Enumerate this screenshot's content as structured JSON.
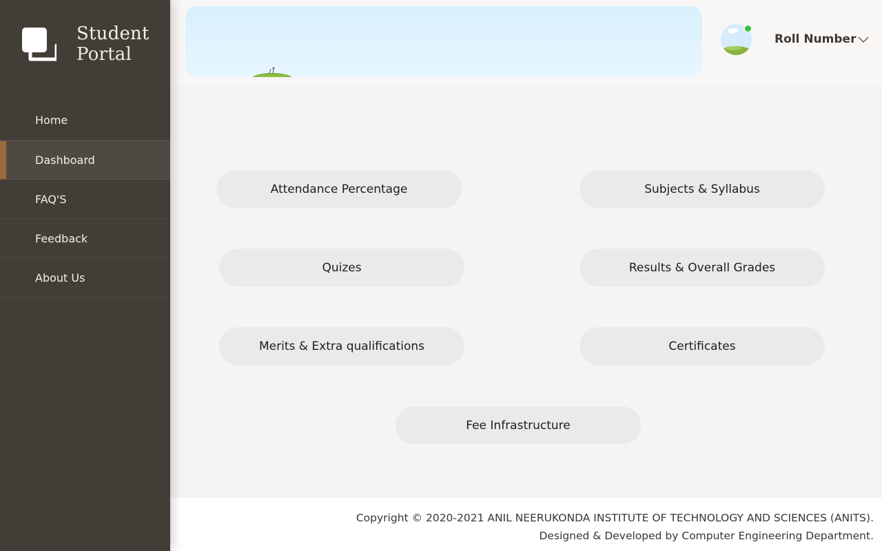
{
  "brand": {
    "title_line1": "Student",
    "title_line2": "Portal"
  },
  "sidebar": {
    "items": [
      {
        "label": "Home",
        "active": false
      },
      {
        "label": "Dashboard",
        "active": true
      },
      {
        "label": "FAQ'S",
        "active": false
      },
      {
        "label": "Feedback",
        "active": false
      },
      {
        "label": "About Us",
        "active": false
      }
    ]
  },
  "header": {
    "user_menu_label": "Roll Number",
    "avatar_status": "online"
  },
  "dashboard": {
    "buttons": [
      "Attendance Percentage",
      "Subjects & Syllabus",
      "Quizes",
      "Results & Overall Grades",
      "Merits & Extra qualifications",
      "Certificates",
      "Fee Infrastructure"
    ]
  },
  "footer": {
    "copyright": "Copyright © 2020-2021 ANIL NEERUKONDA INSTITUTE OF TECHNOLOGY AND SCIENCES (ANITS).",
    "credits": "Designed & Developed by Computer Engineering Department."
  },
  "colors": {
    "sidebar_bg": "#433d37",
    "accent": "#9b6a3c",
    "status_online": "#3cc23c",
    "button_bg": "#ebeae9"
  }
}
